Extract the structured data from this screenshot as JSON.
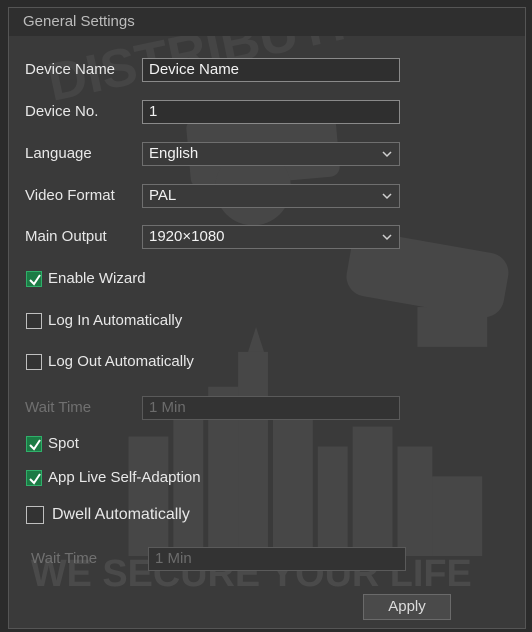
{
  "title": "General Settings",
  "watermark": {
    "top": "DISTRIBUTION",
    "bottom": "WE SECURE YOUR LIFE"
  },
  "device_name": {
    "label": "Device Name",
    "value": "Device Name"
  },
  "device_no": {
    "label": "Device No.",
    "value": "1"
  },
  "language": {
    "label": "Language",
    "value": "English"
  },
  "video_format": {
    "label": "Video Format",
    "value": "PAL"
  },
  "main_output": {
    "label": "Main Output",
    "value": "1920×1080"
  },
  "checks": {
    "enable_wizard": "Enable Wizard",
    "log_in_auto": "Log In Automatically",
    "log_out_auto": "Log Out Automatically",
    "spot": "Spot",
    "app_live": "App Live Self-Adaption",
    "dwell_auto": "Dwell Automatically"
  },
  "wait_time_1": {
    "label": "Wait Time",
    "value": "1 Min"
  },
  "wait_time_2": {
    "label": "Wait Time",
    "value": "1 Min"
  },
  "apply": "Apply",
  "colors": {
    "check_on": "#1c7b45",
    "panel": "#3a3a3a"
  }
}
